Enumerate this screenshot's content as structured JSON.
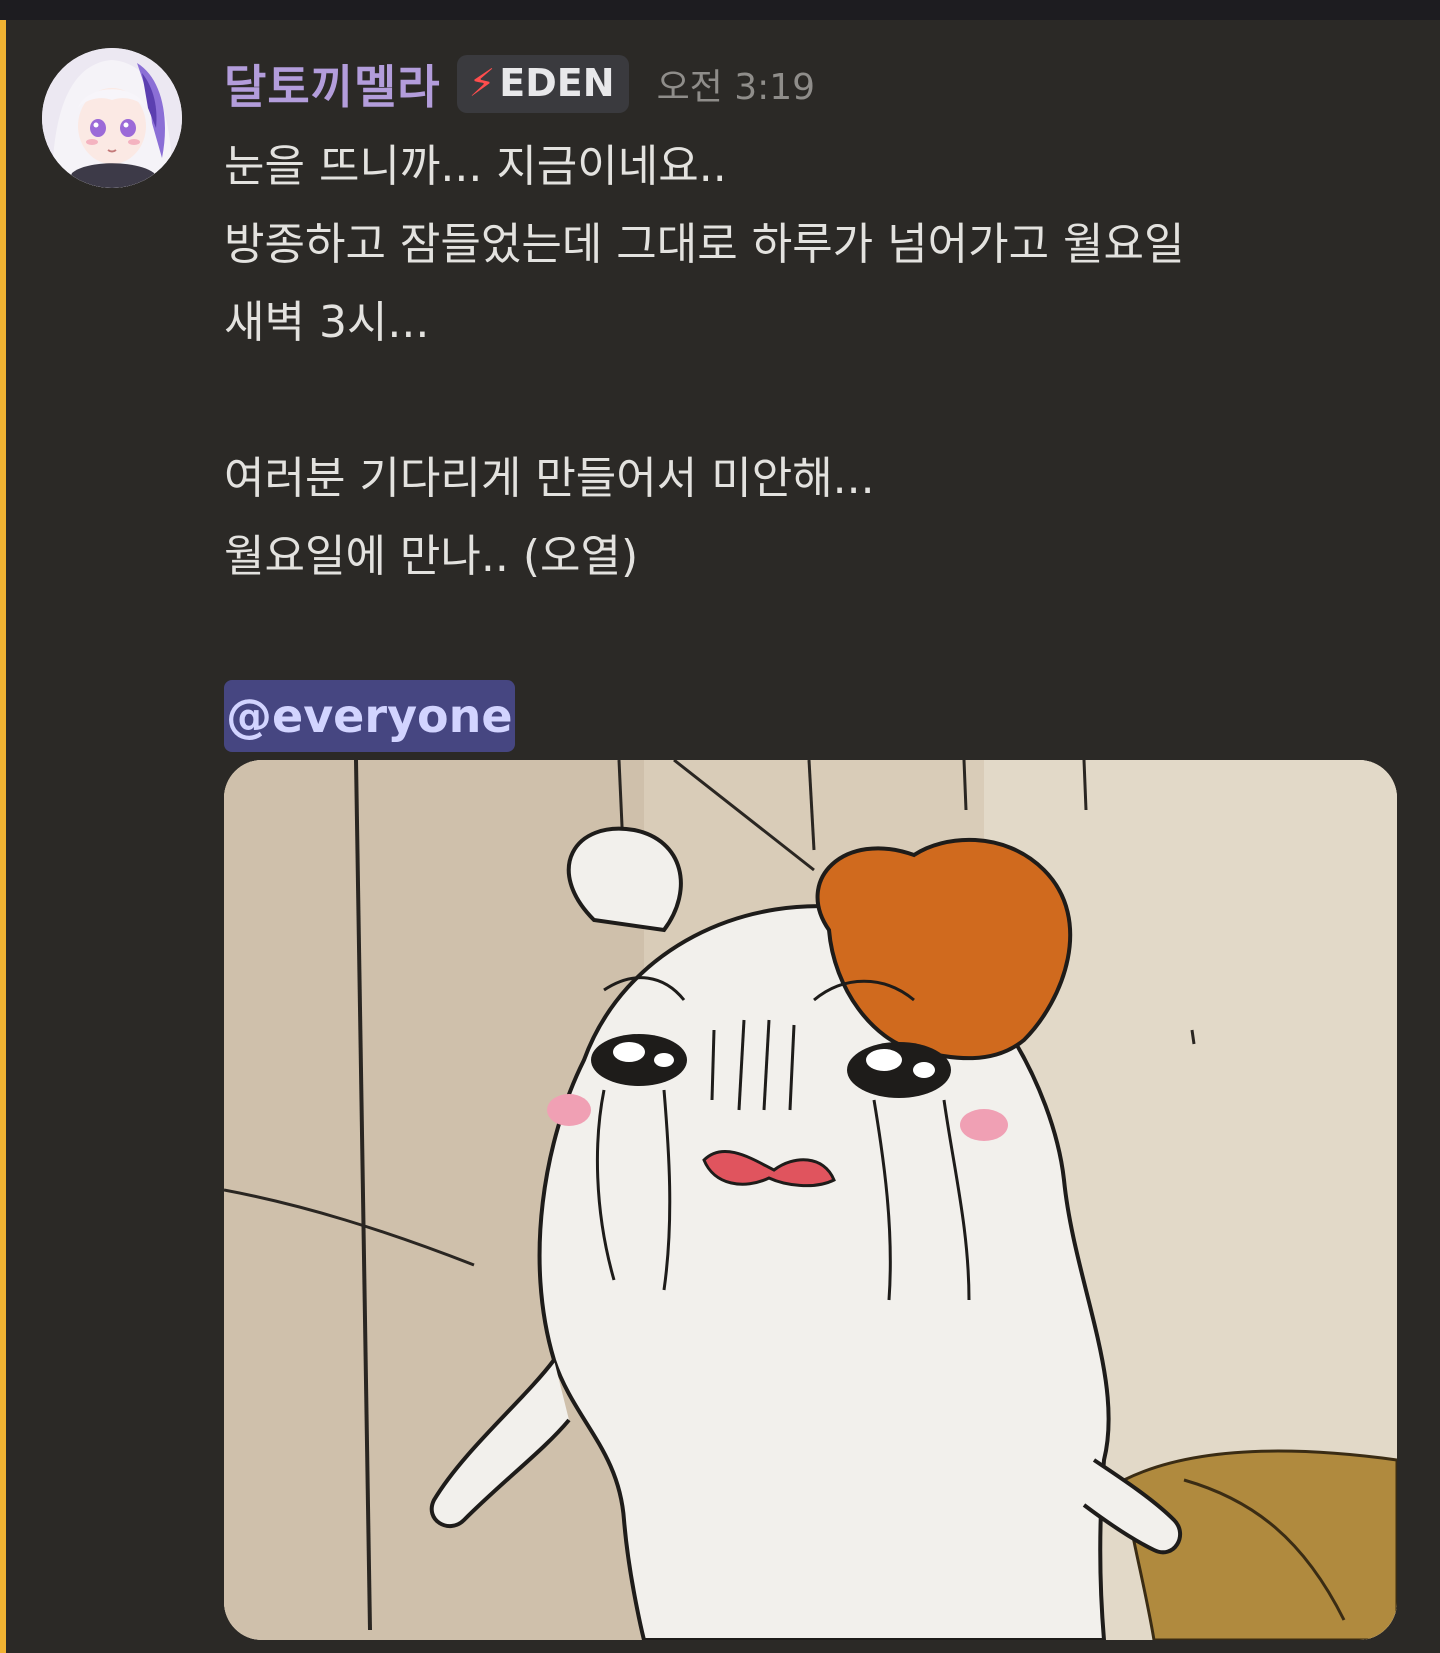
{
  "message": {
    "author": {
      "name": "달토끼멜라",
      "name_color": "#b39ddb",
      "avatar_icon": "anime-girl-avatar"
    },
    "role_tag": {
      "icon": "lightning-icon",
      "label": "EDEN"
    },
    "timestamp": "오전 3:19",
    "lines": [
      "눈을 뜨니까... 지금이네요..",
      "방종하고 잠들었는데 그대로 하루가 넘어가고 월요일",
      "새벽 3시...",
      "",
      "여러분 기다리게 만들어서 미안해...",
      "월요일에 만나.. (오열)",
      ""
    ],
    "mention": "@everyone",
    "attachment": {
      "type": "image",
      "subject": "crying-hamster-cartoon"
    }
  },
  "colors": {
    "background": "#2b2926",
    "mention_highlight_bar": "#f0b232",
    "mention_bg": "#464681",
    "mention_text": "#d2d4ff",
    "text": "#e3e2df"
  }
}
